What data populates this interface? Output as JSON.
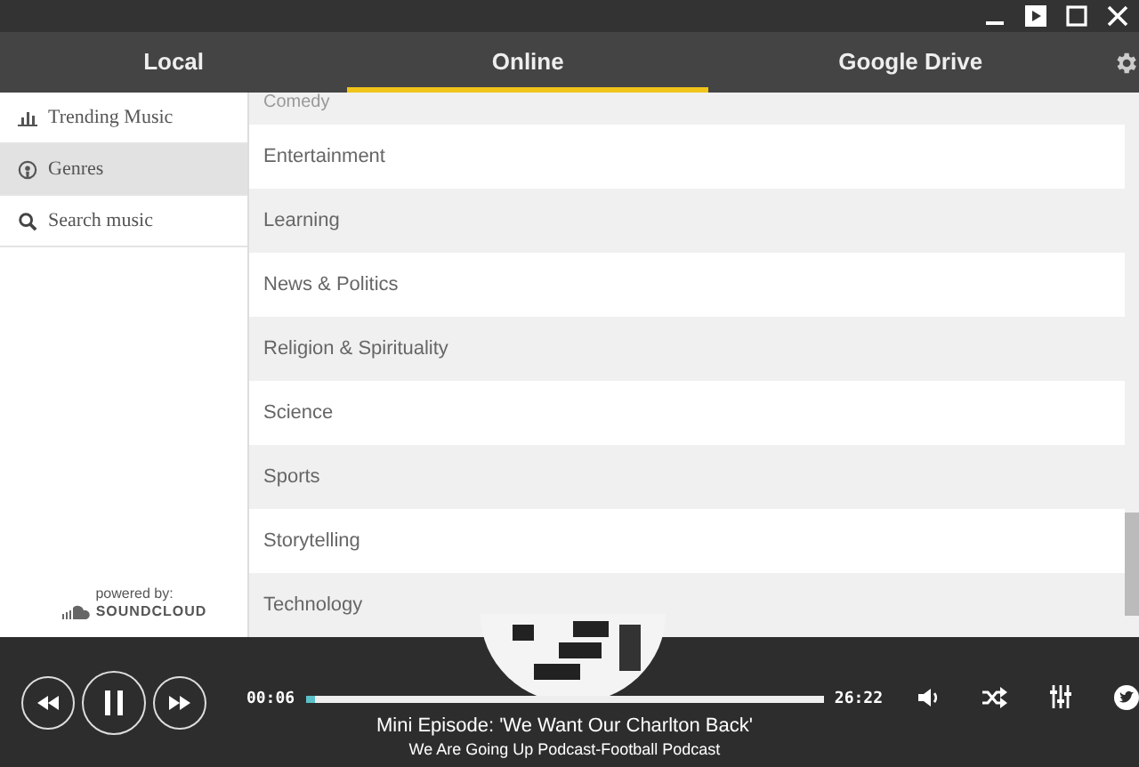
{
  "tabs": [
    {
      "label": "Local",
      "selected": false
    },
    {
      "label": "Online",
      "selected": true
    },
    {
      "label": "Google Drive",
      "selected": false
    }
  ],
  "sidebar": {
    "items": [
      {
        "label": "Trending Music",
        "selected": false
      },
      {
        "label": "Genres",
        "selected": true
      },
      {
        "label": "Search music",
        "selected": false
      }
    ],
    "powered_by": "powered by:",
    "brand": "SOUNDCLOUD"
  },
  "genres": [
    "Comedy",
    "Entertainment",
    "Learning",
    "News & Politics",
    "Religion & Spirituality",
    "Science",
    "Sports",
    "Storytelling",
    "Technology"
  ],
  "player": {
    "elapsed": "00:06",
    "duration": "26:22",
    "level": 0.02,
    "title": "Mini Episode: 'We Want Our Charlton Back'",
    "subtitle": "We Are Going Up Podcast-Football Podcast"
  }
}
